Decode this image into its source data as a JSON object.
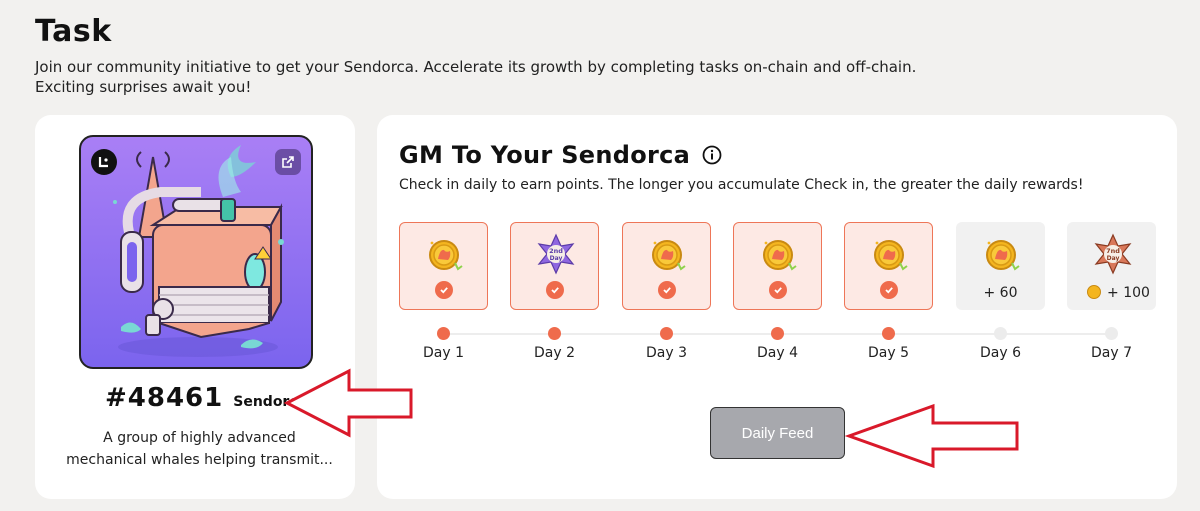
{
  "page": {
    "title": "Task",
    "description_line1": "Join our community initiative to get your Sendorca. Accelerate its growth by completing tasks on-chain and off-chain.",
    "description_line2": "Exciting surprises await you!"
  },
  "nft": {
    "number": "#48461",
    "collection": "Sendorca",
    "description_line1": "A group of highly advanced",
    "description_line2": "mechanical whales helping transmit..."
  },
  "checkin": {
    "title": "GM To Your Sendorca",
    "description": "Check in daily to earn points. The longer you accumulate Check in, the greater the daily rewards!",
    "days": [
      {
        "label": "Day 1",
        "checked": true,
        "reward": "coin"
      },
      {
        "label": "Day 2",
        "checked": true,
        "reward": "2nd Day"
      },
      {
        "label": "Day 3",
        "checked": true,
        "reward": "coin"
      },
      {
        "label": "Day 4",
        "checked": true,
        "reward": "coin"
      },
      {
        "label": "Day 5",
        "checked": true,
        "reward": "coin"
      },
      {
        "label": "Day 6",
        "checked": false,
        "reward": "coin",
        "points": "+ 60"
      },
      {
        "label": "Day 7",
        "checked": false,
        "reward": "7nd Day",
        "points": "+ 100"
      }
    ],
    "button_label": "Daily Feed"
  },
  "colors": {
    "accent": "#ef6b4c",
    "checked_tile": "#fde9e4",
    "button": "#a7a8ad",
    "annotation_arrow": "#d9192a"
  }
}
